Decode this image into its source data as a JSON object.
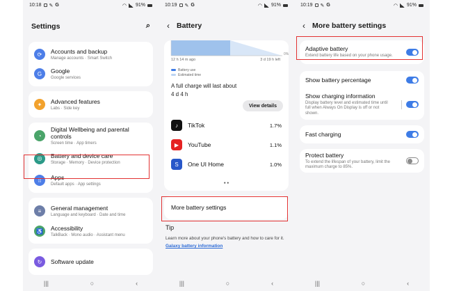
{
  "left": {
    "time": "10:18",
    "battery": "91%",
    "title": "Settings",
    "groups": [
      [
        {
          "label": "Accounts and backup",
          "sub": "Manage accounts · Smart Switch",
          "color": "#4d7ee8",
          "icon": "sync-icon",
          "glyph": "⟳"
        },
        {
          "label": "Google",
          "sub": "Google services",
          "color": "#4d7ee8",
          "icon": "google-icon",
          "glyph": "G"
        }
      ],
      [
        {
          "label": "Advanced features",
          "sub": "Labs · Side key",
          "color": "#f2a22d",
          "icon": "star-icon",
          "glyph": "✦"
        }
      ],
      [
        {
          "label": "Digital Wellbeing and parental controls",
          "sub": "Screen time · App timers",
          "color": "#4aa46a",
          "icon": "wellbeing-icon",
          "glyph": "◔"
        },
        {
          "label": "Battery and device care",
          "sub": "Storage · Memory · Device protection",
          "color": "#2b9a88",
          "icon": "device-care-icon",
          "glyph": "◎"
        },
        {
          "label": "Apps",
          "sub": "Default apps · App settings",
          "color": "#4d7ee8",
          "icon": "apps-icon",
          "glyph": "⠿"
        }
      ],
      [
        {
          "label": "General management",
          "sub": "Language and keyboard · Date and time",
          "color": "#6d7ea8",
          "icon": "sliders-icon",
          "glyph": "≡"
        },
        {
          "label": "Accessibility",
          "sub": "TalkBack · Mono audio · Assistant menu",
          "color": "#4aa46a",
          "icon": "accessibility-icon",
          "glyph": "♿"
        }
      ],
      [
        {
          "label": "Software update",
          "sub": "",
          "color": "#7a5be0",
          "icon": "update-icon",
          "glyph": "↻"
        }
      ]
    ]
  },
  "middle": {
    "time": "10:19",
    "battery": "91%",
    "title": "Battery",
    "chart": {
      "pct_label": "0%",
      "start_label": "12 h 14 m ago",
      "end_label": "3 d 19 h left"
    },
    "legend": [
      "Battery use",
      "Estimated time"
    ],
    "charge_text": "A full charge will last about",
    "charge_value": "4 d 4 h",
    "view_details": "View details",
    "apps": [
      {
        "name": "TikTok",
        "pct": "1.7%",
        "icon": "tiktok-icon",
        "glyph": "♪",
        "color": "#111"
      },
      {
        "name": "YouTube",
        "pct": "1.1%",
        "icon": "youtube-icon",
        "glyph": "▶",
        "color": "#e52222"
      },
      {
        "name": "One UI Home",
        "pct": "1.0%",
        "icon": "oneui-home-icon",
        "glyph": "S",
        "color": "#2857c9"
      }
    ],
    "more_settings": "More battery settings",
    "tip_title": "Tip",
    "tip_text": "Learn more about your phone's battery and how to care for it.",
    "tip_link": "Galaxy battery information"
  },
  "right": {
    "time": "10:19",
    "battery": "91%",
    "title": "More battery settings",
    "items": [
      {
        "label": "Adaptive battery",
        "sub": "Extend battery life based on your phone usage.",
        "on": true
      },
      {
        "label": "Show battery percentage",
        "sub": "",
        "on": true
      },
      {
        "label": "Show charging information",
        "sub": "Display battery level and estimated time until full when Always On Display is off or not shown.",
        "on": true
      },
      {
        "label": "Fast charging",
        "sub": "",
        "on": true
      },
      {
        "label": "Protect battery",
        "sub": "To extend the lifespan of your battery, limit the maximum charge to 85%.",
        "on": false
      }
    ]
  },
  "nav": {
    "recents": "|||",
    "home": "○",
    "back": "‹"
  }
}
